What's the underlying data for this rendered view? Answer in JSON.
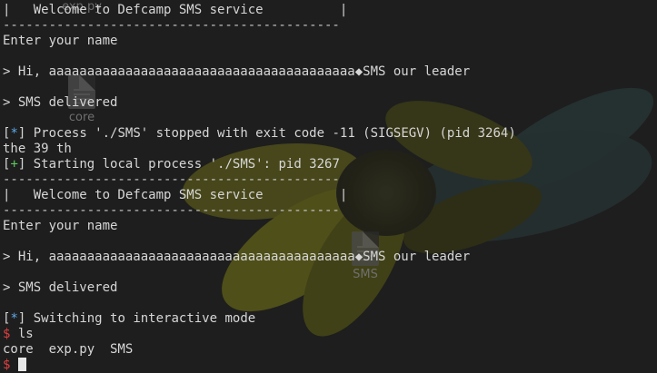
{
  "desktop_icons": [
    {
      "label": "exp.py",
      "icon": "python-file-icon"
    },
    {
      "label": "core",
      "icon": "file-icon"
    },
    {
      "label": "SMS",
      "icon": "file-icon"
    }
  ],
  "terminal": {
    "lines": {
      "l0": "|   Welcome to Defcamp SMS service          |",
      "l1": "--------------------------------------------",
      "l2": "Enter your name",
      "l3": "",
      "l4": "> Hi, aaaaaaaaaaaaaaaaaaaaaaaaaaaaaaaaaaaaaaaa◆SMS our leader",
      "l5": "",
      "l6": "> SMS delivered",
      "l7": "",
      "l8_tag_open": "[",
      "l8_tag_mark": "*",
      "l8_tag_close": "]",
      "l8_text": " Process './SMS' stopped with exit code -11 (SIGSEGV) (pid 3264)",
      "l9": "the 39 th",
      "l10_tag_open": "[",
      "l10_tag_mark": "+",
      "l10_tag_close": "]",
      "l10_text": " Starting local process './SMS': pid 3267",
      "l11": "--------------------------------------------",
      "l12": "|   Welcome to Defcamp SMS service          |",
      "l13": "--------------------------------------------",
      "l14": "Enter your name",
      "l15": "",
      "l16": "> Hi, aaaaaaaaaaaaaaaaaaaaaaaaaaaaaaaaaaaaaaaa◆SMS our leader",
      "l17": "",
      "l18": "> SMS delivered",
      "l19": "",
      "l20_tag_open": "[",
      "l20_tag_mark": "*",
      "l20_tag_close": "]",
      "l20_text": " Switching to interactive mode",
      "l21_prompt": "$",
      "l21_cmd": " ls",
      "l22": "core  exp.py  SMS",
      "l23_prompt": "$"
    }
  },
  "colors": {
    "info_tag": "#5fa8e6",
    "success_tag": "#5fc85f",
    "prompt": "#e04040",
    "text": "#d6d6d6",
    "background": "#1e1e1e"
  }
}
